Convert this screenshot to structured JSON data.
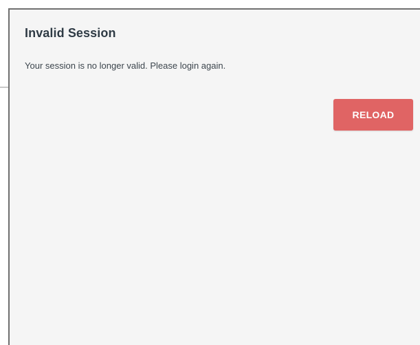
{
  "dialog": {
    "title": "Invalid Session",
    "message": "Your session is no longer valid. Please login again.",
    "reload_label": "RELOAD"
  },
  "colors": {
    "button_background": "#e06464",
    "dialog_background": "#f5f5f5",
    "title_text": "#2f3b45"
  }
}
